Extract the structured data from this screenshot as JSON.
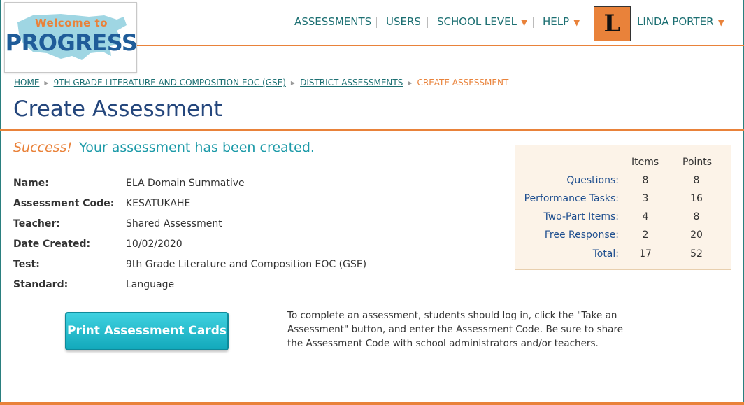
{
  "logo": {
    "welcome": "Welcome to",
    "brand": "PROGRESS"
  },
  "nav": {
    "assessments": "ASSESSMENTS",
    "users": "USERS",
    "school_level": "SCHOOL LEVEL",
    "help": "HELP",
    "user_initial": "L",
    "user_name": "LINDA PORTER"
  },
  "breadcrumb": {
    "home": "HOME",
    "course": "9TH GRADE LITERATURE AND COMPOSITION EOC (GSE)",
    "district": "DISTRICT ASSESSMENTS",
    "current": "CREATE ASSESSMENT"
  },
  "page_title": "Create Assessment",
  "success": {
    "word": "Success!",
    "message": "Your assessment has been created."
  },
  "details": [
    {
      "label": "Name:",
      "value": "ELA Domain Summative"
    },
    {
      "label": "Assessment Code:",
      "value": "KESATUKAHE"
    },
    {
      "label": "Teacher:",
      "value": "Shared Assessment"
    },
    {
      "label": "Date Created:",
      "value": "10/02/2020"
    },
    {
      "label": "Test:",
      "value": "9th Grade Literature and Composition EOC (GSE)"
    },
    {
      "label": "Standard:",
      "value": "Language"
    }
  ],
  "summary": {
    "col_items": "Items",
    "col_points": "Points",
    "rows": [
      {
        "label": "Questions:",
        "items": "8",
        "points": "8"
      },
      {
        "label": "Performance Tasks:",
        "items": "3",
        "points": "16"
      },
      {
        "label": "Two-Part Items:",
        "items": "4",
        "points": "8"
      },
      {
        "label": "Free Response:",
        "items": "2",
        "points": "20"
      }
    ],
    "total": {
      "label": "Total:",
      "items": "17",
      "points": "52"
    }
  },
  "print_button": "Print Assessment Cards",
  "instructions": "To complete an assessment, students should log in, click the \"Take an Assessment\" button, and enter the Assessment Code. Be sure to share the Assessment Code with school administrators and/or teachers.",
  "colors": {
    "accent_orange": "#e9823a",
    "teal": "#1c6f72",
    "navy": "#24467c",
    "button": "#13a9bb"
  }
}
